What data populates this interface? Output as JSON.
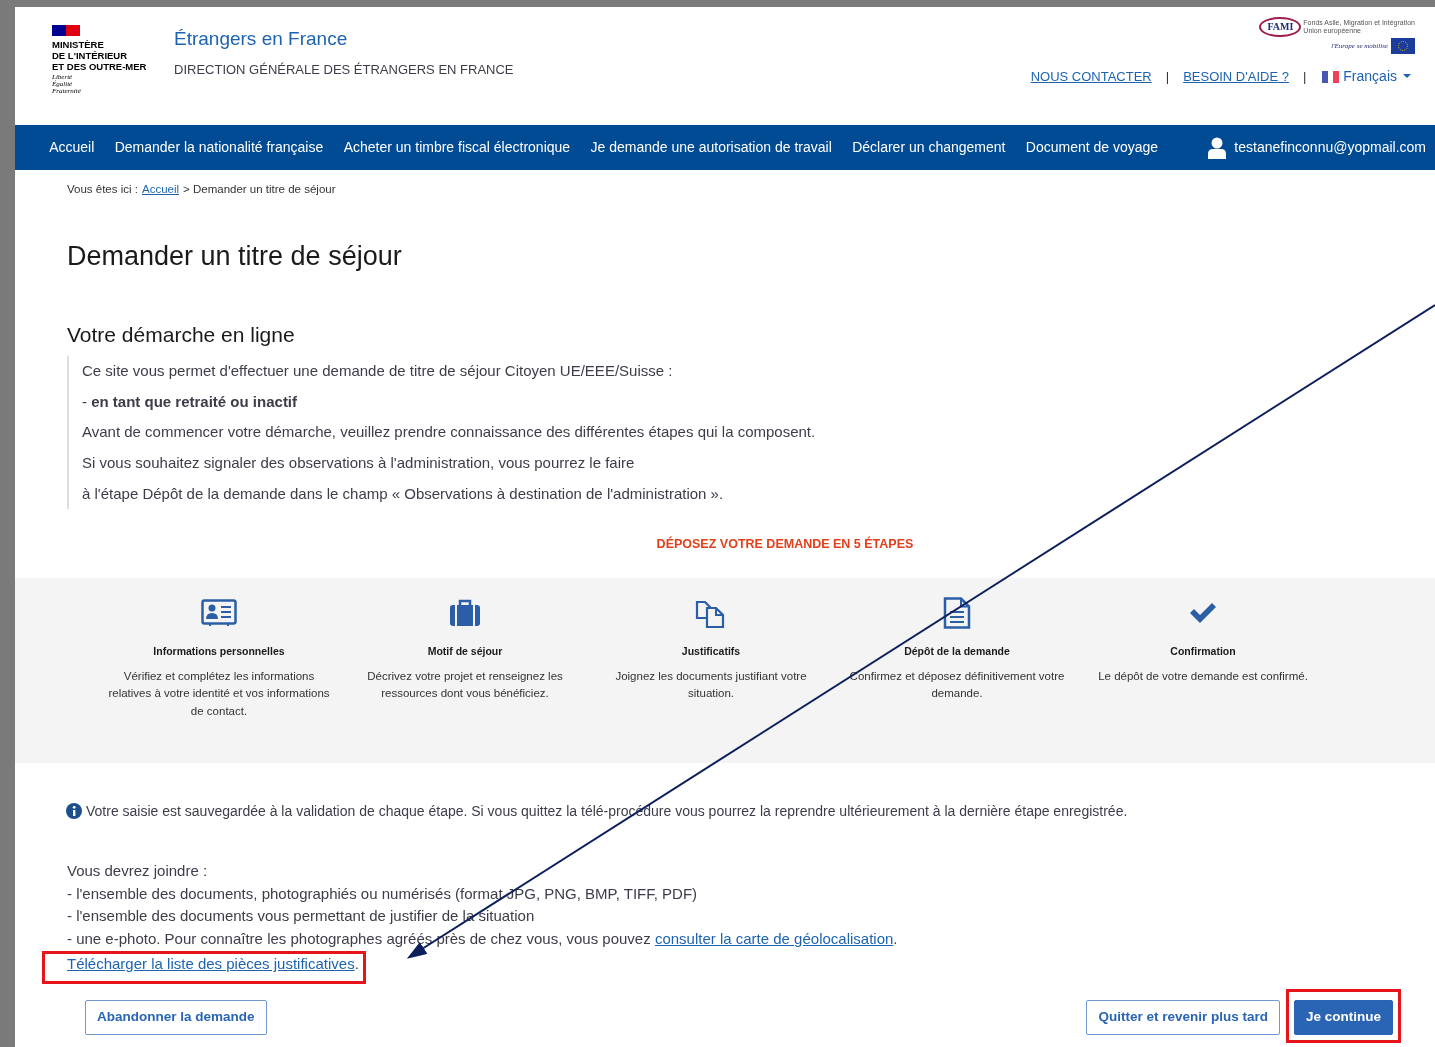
{
  "header": {
    "ministry_logo": {
      "name_lines": [
        "MINISTÈRE",
        "DE L'INTÉRIEUR",
        "ET DES OUTRE-MER"
      ],
      "motto_lines": [
        "Liberté",
        "Égalité",
        "Fraternité"
      ]
    },
    "site_title": "Étrangers en France",
    "site_subtitle": "DIRECTION GÉNÉRALE DES ÉTRANGERS EN FRANCE",
    "fund_logo": {
      "acronym": "FAMI",
      "fund_name": "Fonds Asile, Migration et Intégration",
      "union": "Union européenne",
      "slogan": "l'Europe se mobilise"
    },
    "top_links": [
      "NOUS CONTACTER",
      "BESOIN D'AIDE ?"
    ],
    "separators": [
      "|",
      "|"
    ],
    "language": "Français"
  },
  "nav": {
    "items": [
      "Accueil",
      "Demander la nationalité française",
      "Acheter un timbre fiscal électronique",
      "Je demande une autorisation de travail",
      "Déclarer un changement",
      "Document de voyage"
    ],
    "user": "testanefinconnu@yopmail.com"
  },
  "breadcrumb": {
    "prefix": "Vous êtes ici :",
    "link": "Accueil",
    "current": "> Demander un titre de séjour"
  },
  "page_title": "Demander un titre de séjour",
  "section_title": "Votre démarche en ligne",
  "intro_lines": [
    "Ce site vous permet d'effectuer une demande de titre de séjour Citoyen UE/EEE/Suisse :",
    "- **en tant que retraité ou inactif**",
    "Avant de commencer votre démarche, veuillez prendre connaissance des différentes étapes qui la composent.",
    "Si vous souhaitez signaler des observations à l'administration, vous pourrez le faire",
    "à l'étape Dépôt de la demande dans le champ « Observations à destination de l'administration »."
  ],
  "steps_heading": "DÉPOSEZ VOTRE DEMANDE EN 5 ÉTAPES",
  "steps": [
    {
      "kind": "id-card",
      "title": "Informations personnelles",
      "text": "Vérifiez et complétez les informations relatives à votre identité et vos informations de contact."
    },
    {
      "kind": "briefcase",
      "title": "Motif de séjour",
      "text": "Décrivez votre projet et renseignez les ressources dont vous bénéficiez."
    },
    {
      "kind": "copies",
      "title": "Justificatifs",
      "text": "Joignez les documents justifiant votre situation."
    },
    {
      "kind": "document",
      "title": "Dépôt de la demande",
      "text": "Confirmez et déposez définitivement votre demande."
    },
    {
      "kind": "check",
      "title": "Confirmation",
      "text": "Le dépôt de votre demande est confirmé."
    }
  ],
  "info_note": "Votre saisie est sauvegardée à la validation de chaque étape. Si vous quittez la télé-procédure vous pourrez la reprendre ultérieurement à la dernière étape enregistrée.",
  "requirements": {
    "intro": "Vous devrez joindre :",
    "lines": [
      "- l'ensemble des documents, photographiés ou numérisés (format JPG, PNG, BMP, TIFF, PDF)",
      "- l'ensemble des documents vous permettant de justifier de la situation"
    ],
    "photo_line": {
      "text": "- une e-photo. Pour connaître les photographes agréés près de chez vous, vous pouvez",
      "link": "consulter la carte de géolocalisation",
      "end": "."
    },
    "download": {
      "link": "Télécharger la liste des pièces justificatives",
      "end": ".",
      "highlighted": true
    }
  },
  "buttons": [
    {
      "kind": "secondary",
      "label": "Abandonner la demande",
      "highlighted": false
    },
    {
      "kind": "secondary",
      "label": "Quitter et revenir plus tard",
      "highlighted": false
    },
    {
      "kind": "primary",
      "label": "Je continue",
      "highlighted": true
    }
  ]
}
